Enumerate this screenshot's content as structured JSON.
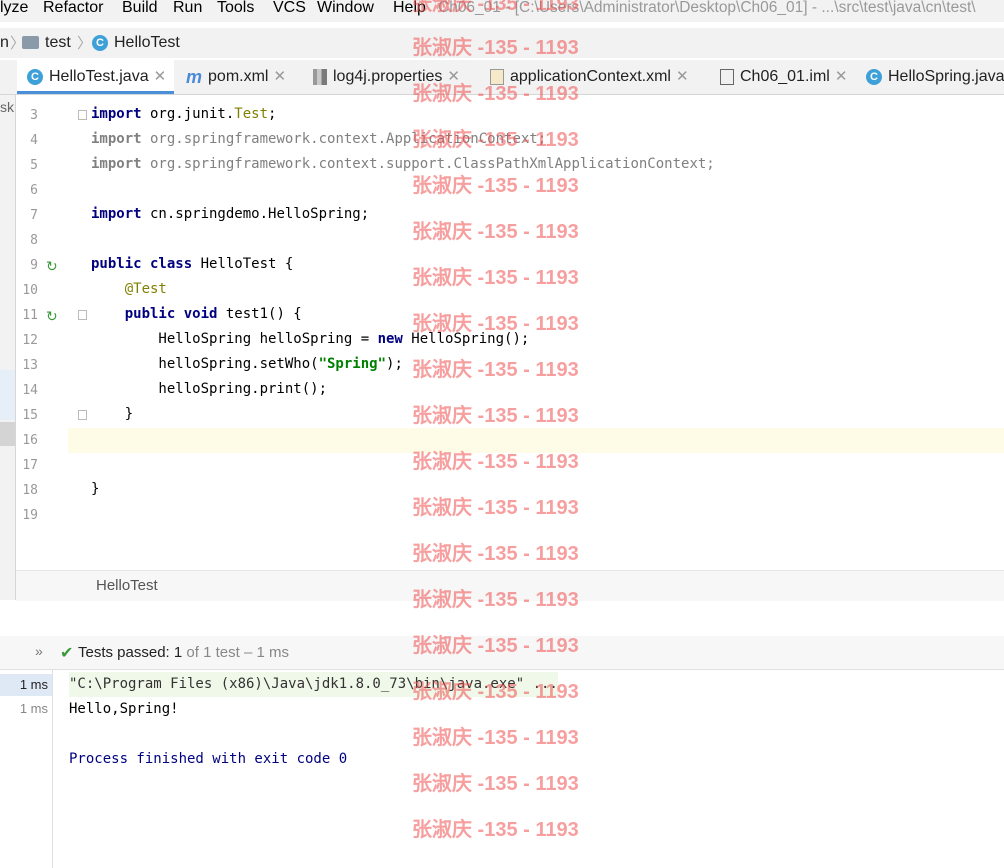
{
  "menu": {
    "items": [
      "lyze",
      "Refactor",
      "Build",
      "Run",
      "Tools",
      "VCS",
      "Window",
      "Help"
    ],
    "window_title": "Ch06_01 - [C:\\Users\\Administrator\\Desktop\\Ch06_01] - ...\\src\\test\\java\\cn\\test\\"
  },
  "breadcrumb": {
    "items": [
      "n",
      "test",
      "HelloTest"
    ]
  },
  "tabs": [
    {
      "label": "HelloTest.java",
      "icon": "c-class-icon"
    },
    {
      "label": "pom.xml",
      "icon": "maven-icon"
    },
    {
      "label": "log4j.properties",
      "icon": "properties-icon"
    },
    {
      "label": "applicationContext.xml",
      "icon": "xml-icon"
    },
    {
      "label": "Ch06_01.iml",
      "icon": "iml-icon"
    },
    {
      "label": "HelloSpring.java",
      "icon": "c-class-icon"
    }
  ],
  "left_strip_text": "sk",
  "editor": {
    "line_numbers": [
      "3",
      "4",
      "5",
      "6",
      "7",
      "8",
      "9",
      "10",
      "11",
      "12",
      "13",
      "14",
      "15",
      "16",
      "17",
      "18",
      "19"
    ],
    "lines": {
      "l3_kw": "import",
      "l3_a": " org.junit.",
      "l3_b": "Test",
      "l3_c": ";",
      "l4_kw": "import",
      "l4_a": " org.springframework.context.ApplicationContext;",
      "l5_kw": "import",
      "l5_a": " org.springframework.context.support.ClassPathXmlApplicationContext;",
      "l7_kw": "import",
      "l7_a": " cn.springdemo.HelloSpring;",
      "l9_kw": "public class",
      "l9_a": " HelloTest {",
      "l10_a": "    @Test",
      "l11_kw": "    public void",
      "l11_a": " test1() {",
      "l12_a": "        HelloSpring helloSpring = ",
      "l12_kw": "new",
      "l12_b": " HelloSpring();",
      "l13_a": "        helloSpring.setWho(",
      "l13_str": "\"Spring\"",
      "l13_b": ");",
      "l14_a": "        helloSpring.print();",
      "l15_a": "    }",
      "l18_a": "}"
    },
    "status_class": "HelloTest"
  },
  "run": {
    "tests_label": "Tests passed:",
    "tests_count": "1",
    "tests_detail": "of 1 test – 1 ms",
    "times": [
      "1 ms",
      "1 ms"
    ],
    "console": [
      "\"C:\\Program Files (x86)\\Java\\jdk1.8.0_73\\bin\\java.exe\" ...",
      "Hello,Spring!",
      "",
      "Process finished with exit code 0"
    ]
  },
  "watermark": "张淑庆 -135 - 1193"
}
